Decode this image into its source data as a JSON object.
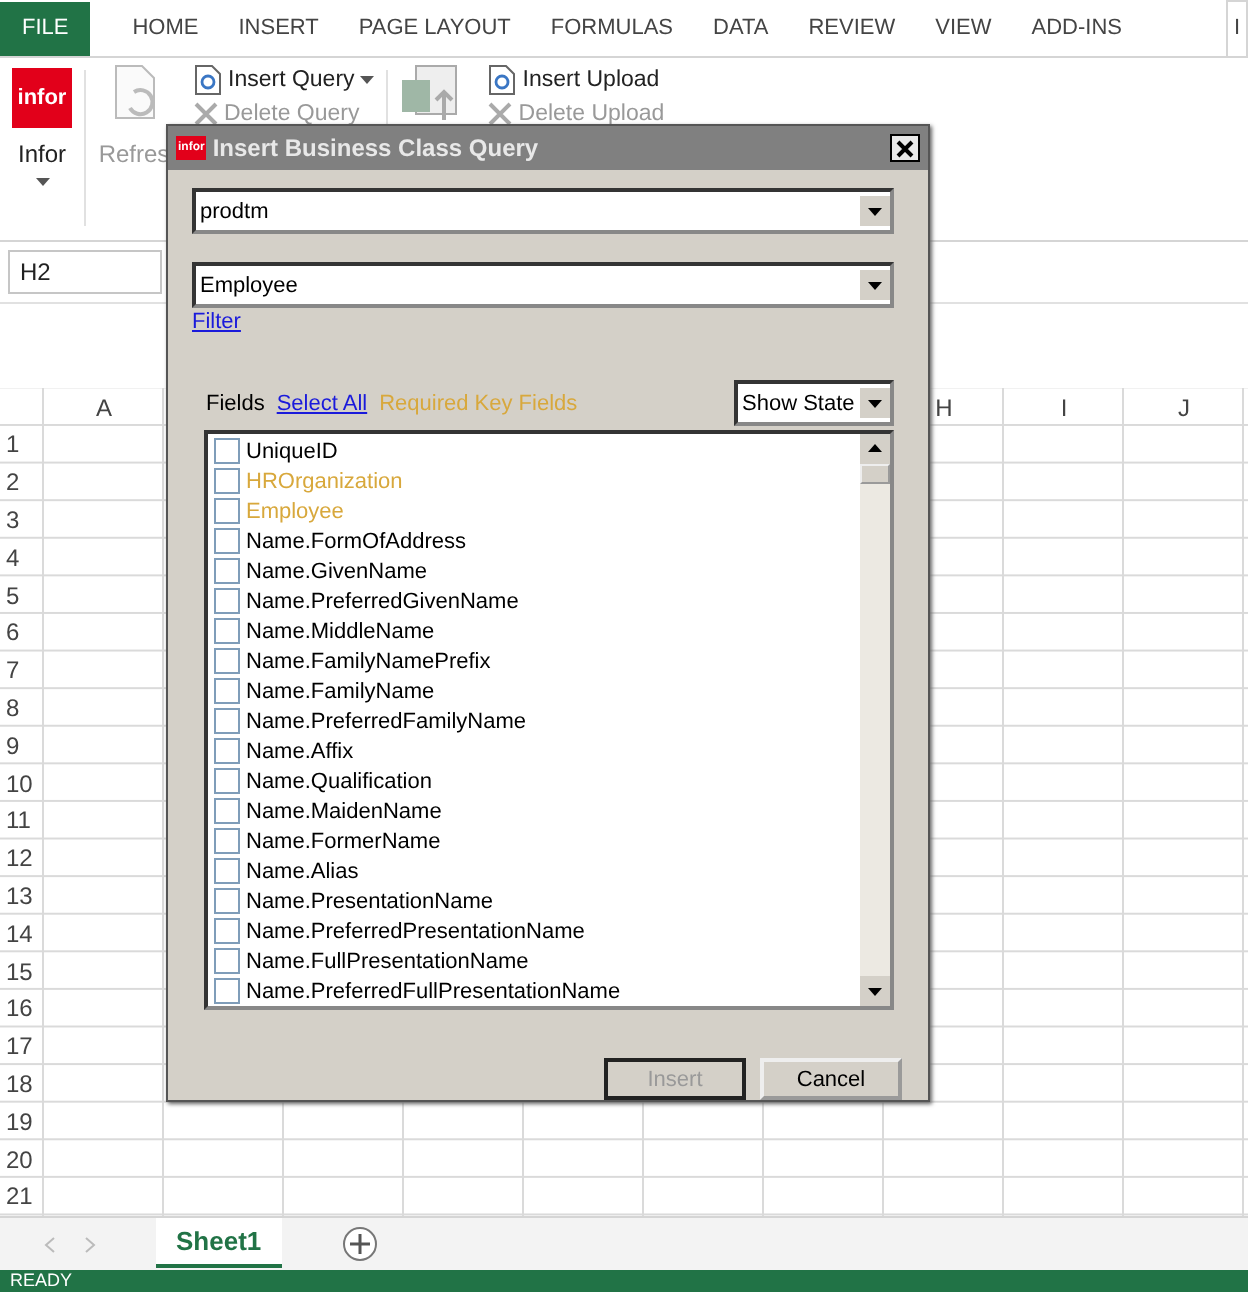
{
  "ribbon_tabs": [
    {
      "label": "FILE",
      "kind": "file",
      "selected": false
    },
    {
      "label": "HOME",
      "kind": "tab",
      "selected": false
    },
    {
      "label": "INSERT",
      "kind": "tab",
      "selected": false
    },
    {
      "label": "PAGE LAYOUT",
      "kind": "tab",
      "selected": false
    },
    {
      "label": "FORMULAS",
      "kind": "tab",
      "selected": false
    },
    {
      "label": "DATA",
      "kind": "tab",
      "selected": false
    },
    {
      "label": "REVIEW",
      "kind": "tab",
      "selected": false
    },
    {
      "label": "VIEW",
      "kind": "tab",
      "selected": false
    },
    {
      "label": "ADD-INS",
      "kind": "tab",
      "selected": false
    },
    {
      "label": "I",
      "kind": "tab",
      "selected": true
    }
  ],
  "ribbon": {
    "logo": "infor",
    "infor_label": "Infor",
    "refresh_label": "Refres",
    "insert_query": "Insert Query",
    "delete_query": "Delete Query",
    "insert_upload": "Insert Upload",
    "delete_upload": "Delete Upload"
  },
  "name_box": "H2",
  "sheet": {
    "columns": [
      "A",
      "H",
      "I",
      "J"
    ],
    "rows": [
      "1",
      "2",
      "3",
      "4",
      "5",
      "6",
      "7",
      "8",
      "9",
      "10",
      "11",
      "12",
      "13",
      "14",
      "15",
      "16",
      "17",
      "18",
      "19",
      "20",
      "21"
    ],
    "tabs": [
      {
        "label": "Sheet1",
        "selected": true
      }
    ]
  },
  "status_bar": "READY",
  "dialog": {
    "title": "Insert Business Class Query",
    "logo": "infor",
    "database": "prodtm",
    "business_class": "Employee",
    "filter_link": "Filter",
    "fields_label": "Fields",
    "select_all": "Select All",
    "required_key_fields": "Required Key Fields",
    "show_state": "Show State",
    "fields": [
      {
        "name": "UniqueID",
        "required": false,
        "checked": false
      },
      {
        "name": "HROrganization",
        "required": true,
        "checked": false
      },
      {
        "name": "Employee",
        "required": true,
        "checked": false
      },
      {
        "name": "Name.FormOfAddress",
        "required": false,
        "checked": false
      },
      {
        "name": "Name.GivenName",
        "required": false,
        "checked": false
      },
      {
        "name": "Name.PreferredGivenName",
        "required": false,
        "checked": false
      },
      {
        "name": "Name.MiddleName",
        "required": false,
        "checked": false
      },
      {
        "name": "Name.FamilyNamePrefix",
        "required": false,
        "checked": false
      },
      {
        "name": "Name.FamilyName",
        "required": false,
        "checked": false
      },
      {
        "name": "Name.PreferredFamilyName",
        "required": false,
        "checked": false
      },
      {
        "name": "Name.Affix",
        "required": false,
        "checked": false
      },
      {
        "name": "Name.Qualification",
        "required": false,
        "checked": false
      },
      {
        "name": "Name.MaidenName",
        "required": false,
        "checked": false
      },
      {
        "name": "Name.FormerName",
        "required": false,
        "checked": false
      },
      {
        "name": "Name.Alias",
        "required": false,
        "checked": false
      },
      {
        "name": "Name.PresentationName",
        "required": false,
        "checked": false
      },
      {
        "name": "Name.PreferredPresentationName",
        "required": false,
        "checked": false
      },
      {
        "name": "Name.FullPresentationName",
        "required": false,
        "checked": false
      },
      {
        "name": "Name.PreferredFullPresentationName",
        "required": false,
        "checked": false
      }
    ],
    "buttons": [
      {
        "label": "Insert",
        "disabled": true
      },
      {
        "label": "Cancel",
        "disabled": false
      }
    ]
  }
}
